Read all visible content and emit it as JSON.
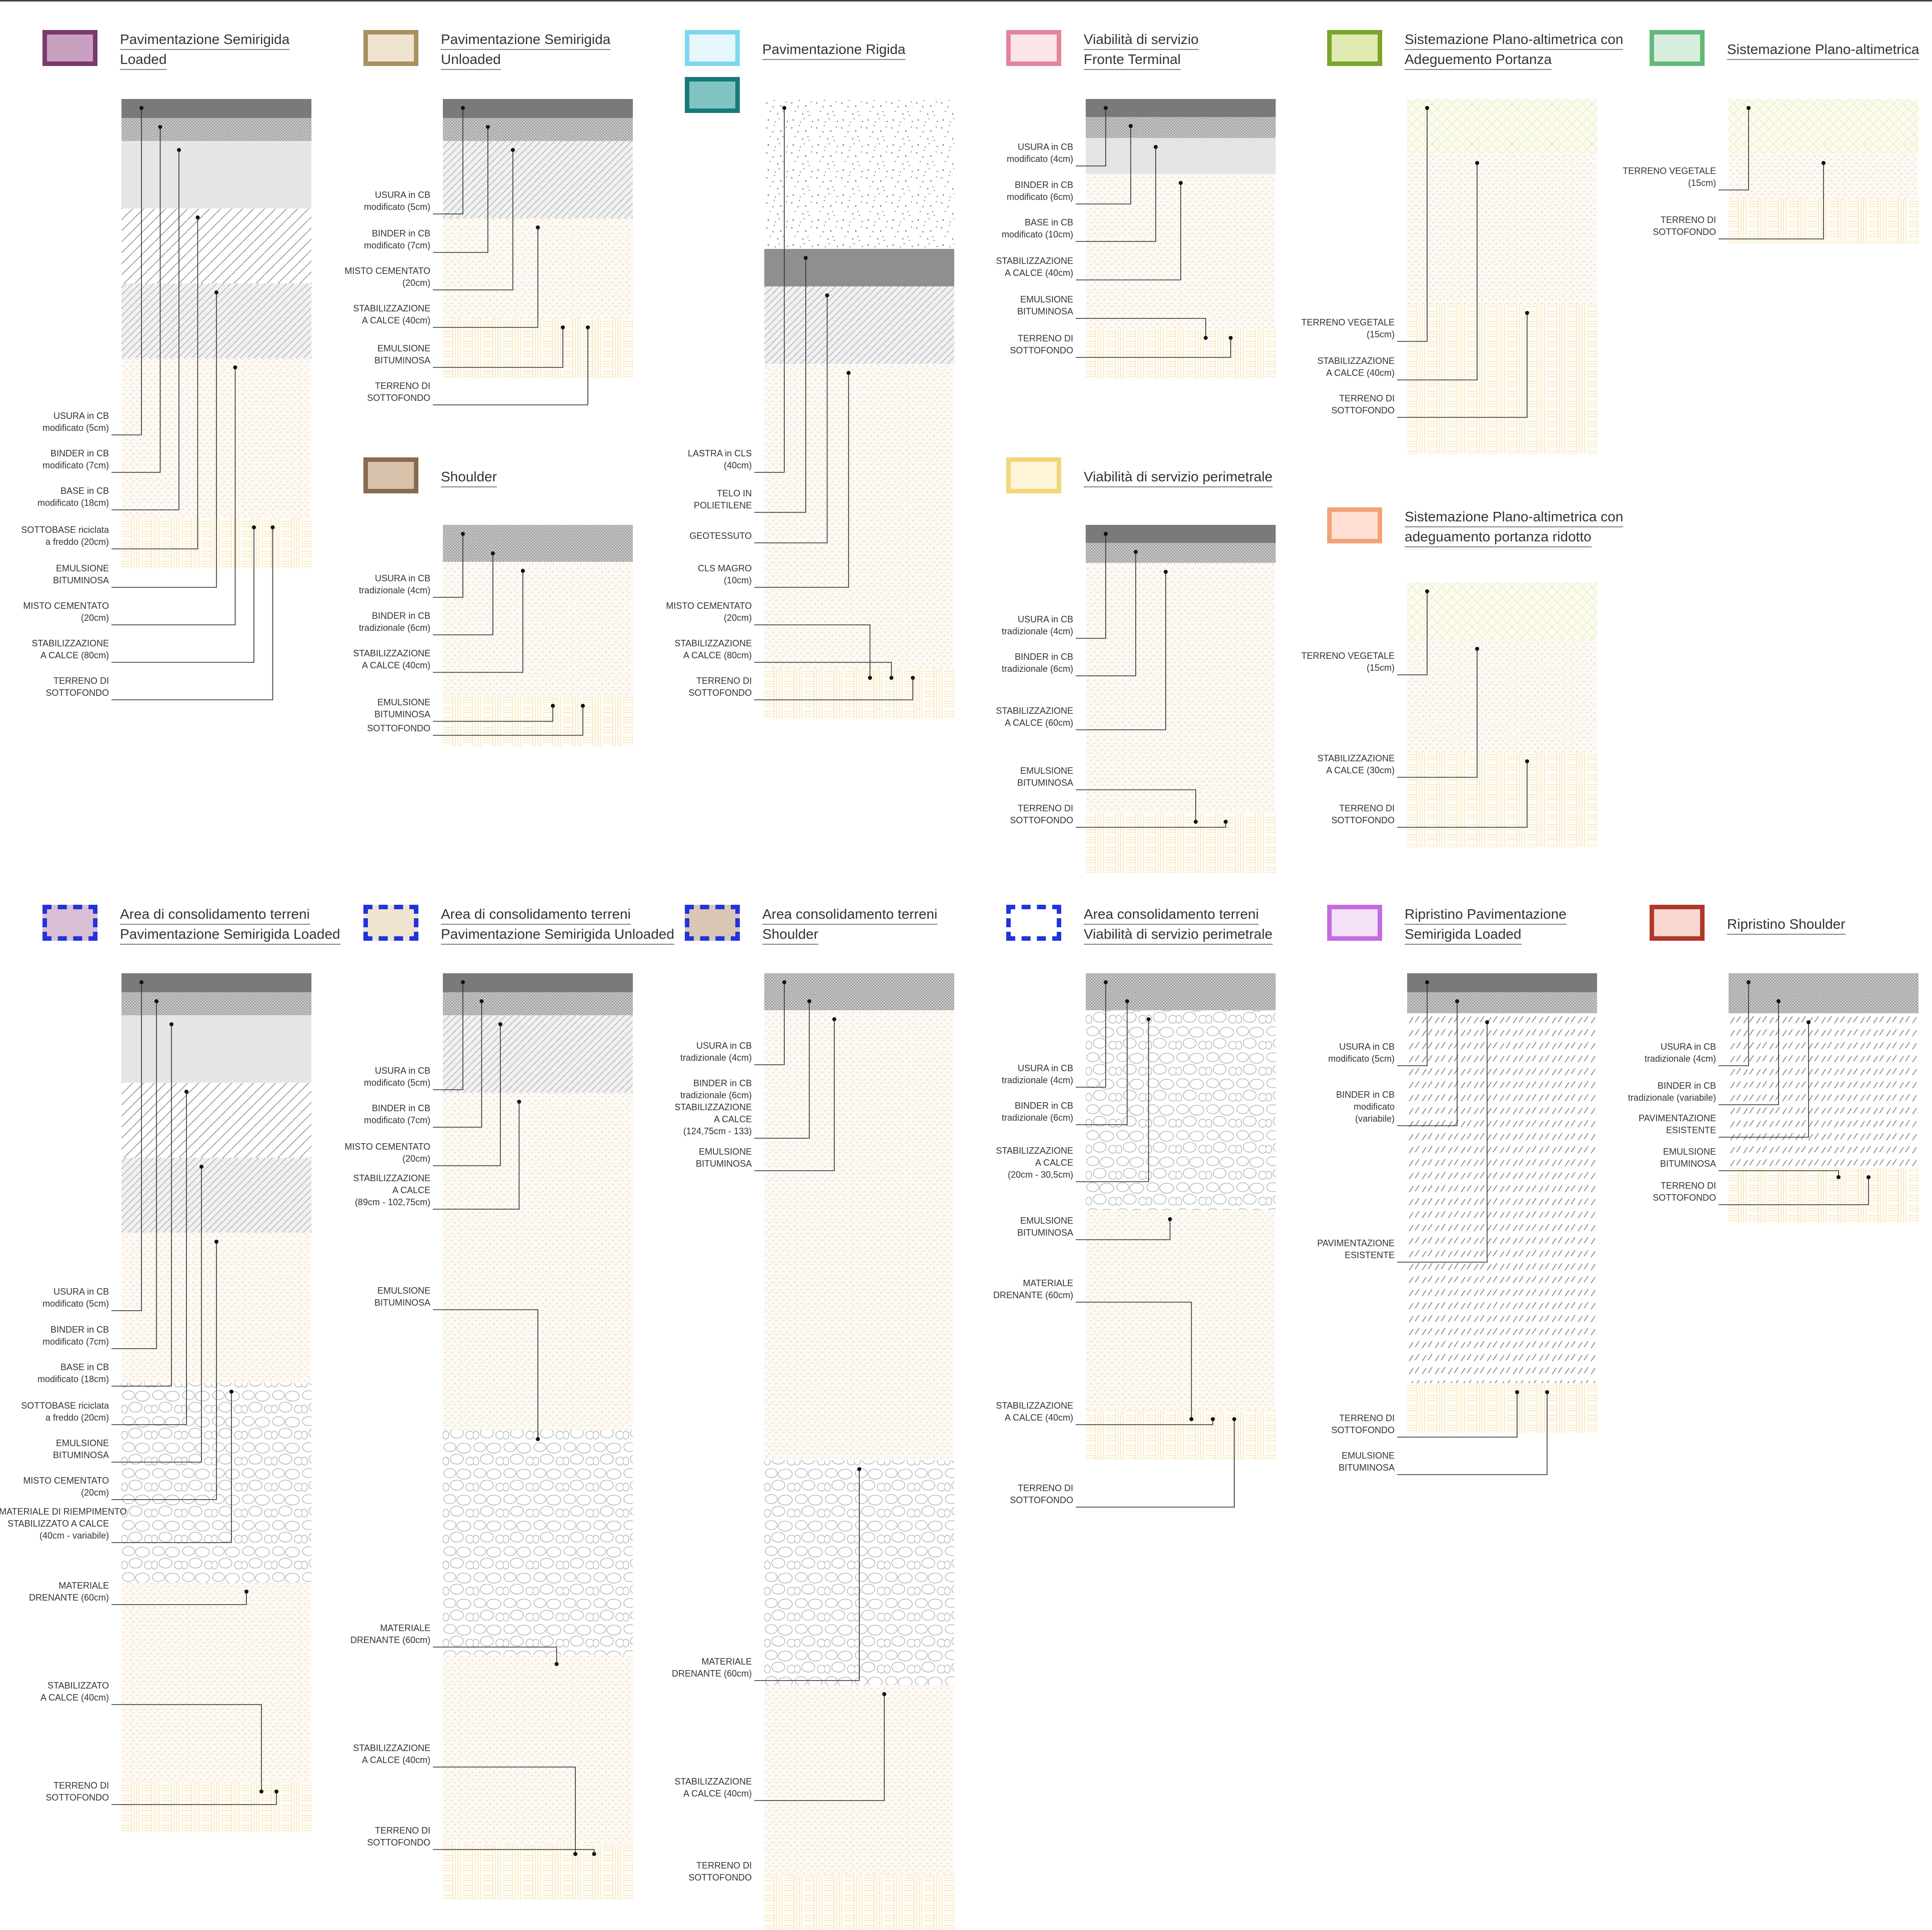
{
  "legends": [
    {
      "id": "l1",
      "lines": [
        "Pavimentazione Semirigida",
        "Loaded"
      ],
      "border": "#7a3a6e",
      "fill": "#c9a0c0",
      "dashed": false
    },
    {
      "id": "l2",
      "lines": [
        "Pavimentazione Semirigida",
        "Unloaded"
      ],
      "border": "#a89060",
      "fill": "#eee4cf",
      "dashed": false
    },
    {
      "id": "l3",
      "lines": [
        "Pavimentazione Rigida"
      ],
      "border": "#7fd6ee",
      "fill": "#e6f7fb",
      "dashed": false,
      "second": {
        "border": "#177a78",
        "fill": "#7fc4c0"
      }
    },
    {
      "id": "l4",
      "lines": [
        "Viabilità di servizio",
        "Fronte Terminal"
      ],
      "border": "#e3849c",
      "fill": "#fbe3e8",
      "dashed": false
    },
    {
      "id": "l5",
      "lines": [
        "Sistemazione Plano-altimetrica con",
        "Adeguemento Portanza"
      ],
      "border": "#7aa52a",
      "fill": "#dfe9b0",
      "dashed": false
    },
    {
      "id": "l6",
      "lines": [
        "Sistemazione Plano-altimetrica"
      ],
      "border": "#62b87a",
      "fill": "#d8efdf",
      "dashed": false
    },
    {
      "id": "l7",
      "lines": [
        "Shoulder"
      ],
      "border": "#8a6a4e",
      "fill": "#d9c2ab",
      "dashed": false
    },
    {
      "id": "l8",
      "lines": [
        "Viabilità di servizio perimetrale"
      ],
      "border": "#f2d77a",
      "fill": "#fdf5d8",
      "dashed": false
    },
    {
      "id": "l9",
      "lines": [
        "Sistemazione Plano-altimetrica con",
        "adeguamento portanza ridotto"
      ],
      "border": "#f4a078",
      "fill": "#fde0d2",
      "dashed": false
    },
    {
      "id": "l10",
      "lines": [
        "Area di consolidamento terreni",
        "Pavimentazione Semirigida Loaded"
      ],
      "border": "#2233dd",
      "fill": "#d9bfd6",
      "dashed": true
    },
    {
      "id": "l11",
      "lines": [
        "Area di consolidamento terreni",
        "Pavimentazione Semirigida Unloaded"
      ],
      "border": "#2233dd",
      "fill": "#eee4cf",
      "dashed": true
    },
    {
      "id": "l12",
      "lines": [
        "Area consolidamento terreni",
        "Shoulder"
      ],
      "border": "#2233dd",
      "fill": "#d9c6b4",
      "dashed": true
    },
    {
      "id": "l13",
      "lines": [
        "Area consolidamento terreni",
        "Viabilità di servizio perimetrale"
      ],
      "border": "#2233dd",
      "fill": "#ffffff",
      "dashed": true
    },
    {
      "id": "l14",
      "lines": [
        "Ripristino Pavimentazione",
        "Semirigida Loaded"
      ],
      "border": "#c36be0",
      "fill": "#f3e1f8",
      "dashed": false
    },
    {
      "id": "l15",
      "lines": [
        "Ripristino Shoulder"
      ],
      "border": "#b0382a",
      "fill": "#f6d8d0",
      "dashed": false
    }
  ],
  "sections": [
    {
      "id": "s1",
      "labels": [
        [
          "USURA in CB",
          "modificato (5cm)"
        ],
        [
          "BINDER in CB",
          "modificato (7cm)"
        ],
        [
          "BASE in CB",
          "modificato (18cm)"
        ],
        [
          "SOTTOBASE riciclata",
          "a freddo (20cm)"
        ],
        [
          "EMULSIONE",
          "BITUMINOSA"
        ],
        [
          "MISTO CEMENTATO",
          "(20cm)"
        ],
        [
          "STABILIZZAZIONE",
          "A CALCE (80cm)"
        ],
        [
          "TERRENO DI",
          "SOTTOFONDO"
        ]
      ]
    },
    {
      "id": "s2",
      "labels": [
        [
          "USURA in CB",
          "modificato (5cm)"
        ],
        [
          "BINDER in CB",
          "modificato (7cm)"
        ],
        [
          "MISTO CEMENTATO",
          "(20cm)"
        ],
        [
          "STABILIZZAZIONE",
          "A CALCE (40cm)"
        ],
        [
          "EMULSIONE",
          "BITUMINOSA"
        ],
        [
          "TERRENO DI",
          "SOTTOFONDO"
        ]
      ]
    },
    {
      "id": "s3",
      "labels": [
        [
          "USURA in CB",
          "tradizionale (4cm)"
        ],
        [
          "BINDER in CB",
          "tradizionale  (6cm)"
        ],
        [
          "STABILIZZAZIONE",
          "A CALCE (40cm)"
        ],
        [
          "EMULSIONE",
          "BITUMINOSA"
        ],
        [
          "SOTTOFONDO"
        ]
      ]
    },
    {
      "id": "s4",
      "labels": [
        [
          "LASTRA in CLS",
          "(40cm)"
        ],
        [
          "TELO IN",
          "POLIETILENE"
        ],
        [
          "GEOTESSUTO"
        ],
        [
          "CLS MAGRO",
          "(10cm)"
        ],
        [
          "MISTO CEMENTATO",
          "(20cm)"
        ],
        [
          "STABILIZZAZIONE",
          "A CALCE (80cm)"
        ],
        [
          "TERRENO DI",
          "SOTTOFONDO"
        ]
      ]
    },
    {
      "id": "s5",
      "labels": [
        [
          "USURA in CB",
          "modificato (4cm)"
        ],
        [
          "BINDER in CB",
          "modificato  (6cm)"
        ],
        [
          "BASE in CB",
          "modificato (10cm)"
        ],
        [
          "STABILIZZAZIONE",
          "A CALCE (40cm)"
        ],
        [
          "EMULSIONE",
          "BITUMINOSA"
        ],
        [
          "TERRENO DI",
          "SOTTOFONDO"
        ]
      ]
    },
    {
      "id": "s6",
      "labels": [
        [
          "USURA in CB",
          "tradizionale (4cm)"
        ],
        [
          "BINDER in CB",
          "tradizionale  (6cm)"
        ],
        [
          "STABILIZZAZIONE",
          "A CALCE (60cm)"
        ],
        [
          "EMULSIONE",
          "BITUMINOSA"
        ],
        [
          "TERRENO DI",
          "SOTTOFONDO"
        ]
      ]
    },
    {
      "id": "s7",
      "labels": [
        [
          "TERRENO VEGETALE",
          "(15cm)"
        ],
        [
          "STABILIZZAZIONE",
          "A CALCE (40cm)"
        ],
        [
          "TERRENO DI",
          "SOTTOFONDO"
        ]
      ]
    },
    {
      "id": "s8",
      "labels": [
        [
          "TERRENO VEGETALE",
          "(15cm)"
        ],
        [
          "STABILIZZAZIONE",
          "A CALCE (30cm)"
        ],
        [
          "TERRENO DI",
          "SOTTOFONDO"
        ]
      ]
    },
    {
      "id": "s9",
      "labels": [
        [
          "TERRENO VEGETALE",
          "(15cm)"
        ],
        [
          "TERRENO DI",
          "SOTTOFONDO"
        ]
      ]
    },
    {
      "id": "s10",
      "labels": [
        [
          "USURA in CB",
          "modificato (5cm)"
        ],
        [
          "BINDER in CB",
          "modificato (7cm)"
        ],
        [
          "BASE in CB",
          "modificato (18cm)"
        ],
        [
          "SOTTOBASE riciclata",
          "a freddo (20cm)"
        ],
        [
          "EMULSIONE",
          "BITUMINOSA"
        ],
        [
          "MISTO CEMENTATO",
          "(20cm)"
        ],
        [
          "MATERIALE DI RIEMPIMENTO",
          "STABILIZZATO A CALCE",
          "(40cm - variabile)"
        ],
        [
          "MATERIALE",
          "DRENANTE (60cm)"
        ],
        [
          "STABILIZZATO",
          "A CALCE (40cm)"
        ],
        [
          "TERRENO DI",
          "SOTTOFONDO"
        ]
      ]
    },
    {
      "id": "s11",
      "labels": [
        [
          "USURA in CB",
          "modificato (5cm)"
        ],
        [
          "BINDER in CB",
          "modificato (7cm)"
        ],
        [
          "MISTO CEMENTATO",
          "(20cm)"
        ],
        [
          "STABILIZZAZIONE",
          "A CALCE",
          "(89cm - 102,75cm)"
        ],
        [
          "EMULSIONE",
          "BITUMINOSA"
        ],
        [
          "MATERIALE",
          "DRENANTE (60cm)"
        ],
        [
          "STABILIZZAZIONE",
          "A CALCE (40cm)"
        ],
        [
          "TERRENO DI",
          "SOTTOFONDO"
        ]
      ]
    },
    {
      "id": "s12",
      "labels": [
        [
          "USURA in CB",
          "tradizionale (4cm)"
        ],
        [
          "BINDER in CB",
          "tradizionale  (6cm)",
          "STABILIZZAZIONE",
          "A CALCE",
          "(124,75cm - 133)"
        ],
        [
          "EMULSIONE",
          "BITUMINOSA"
        ],
        [
          "MATERIALE",
          "DRENANTE (60cm)"
        ],
        [
          "STABILIZZAZIONE",
          "A CALCE (40cm)"
        ],
        [
          "TERRENO DI",
          "SOTTOFONDO"
        ]
      ]
    },
    {
      "id": "s13",
      "labels": [
        [
          "USURA in CB",
          "tradizionale (4cm)"
        ],
        [
          "BINDER in CB",
          "tradizionale  (6cm)"
        ],
        [
          "STABILIZZAZIONE",
          "A CALCE",
          "(20cm - 30,5cm)"
        ],
        [
          "EMULSIONE",
          "BITUMINOSA"
        ],
        [
          "MATERIALE",
          "DRENANTE (60cm)"
        ],
        [
          "STABILIZZAZIONE",
          "A CALCE (40cm)"
        ],
        [
          "TERRENO DI",
          "SOTTOFONDO"
        ]
      ]
    },
    {
      "id": "s14",
      "labels": [
        [
          "USURA in CB",
          "modificato (5cm)"
        ],
        [
          "BINDER in CB",
          "modificato",
          "(variabile)"
        ],
        [
          "PAVIMENTAZIONE",
          "ESISTENTE"
        ],
        [
          "TERRENO DI",
          "SOTTOFONDO"
        ],
        [
          "EMULSIONE",
          "BITUMINOSA"
        ]
      ]
    },
    {
      "id": "s15",
      "labels": [
        [
          "USURA in CB",
          "tradizionale (4cm)"
        ],
        [
          "BINDER in CB",
          "tradizionale  (variabile)"
        ],
        [
          "PAVIMENTAZIONE",
          "ESISTENTE"
        ],
        [
          "EMULSIONE",
          "BITUMINOSA"
        ],
        [
          "TERRENO DI",
          "SOTTOFONDO"
        ]
      ]
    }
  ]
}
